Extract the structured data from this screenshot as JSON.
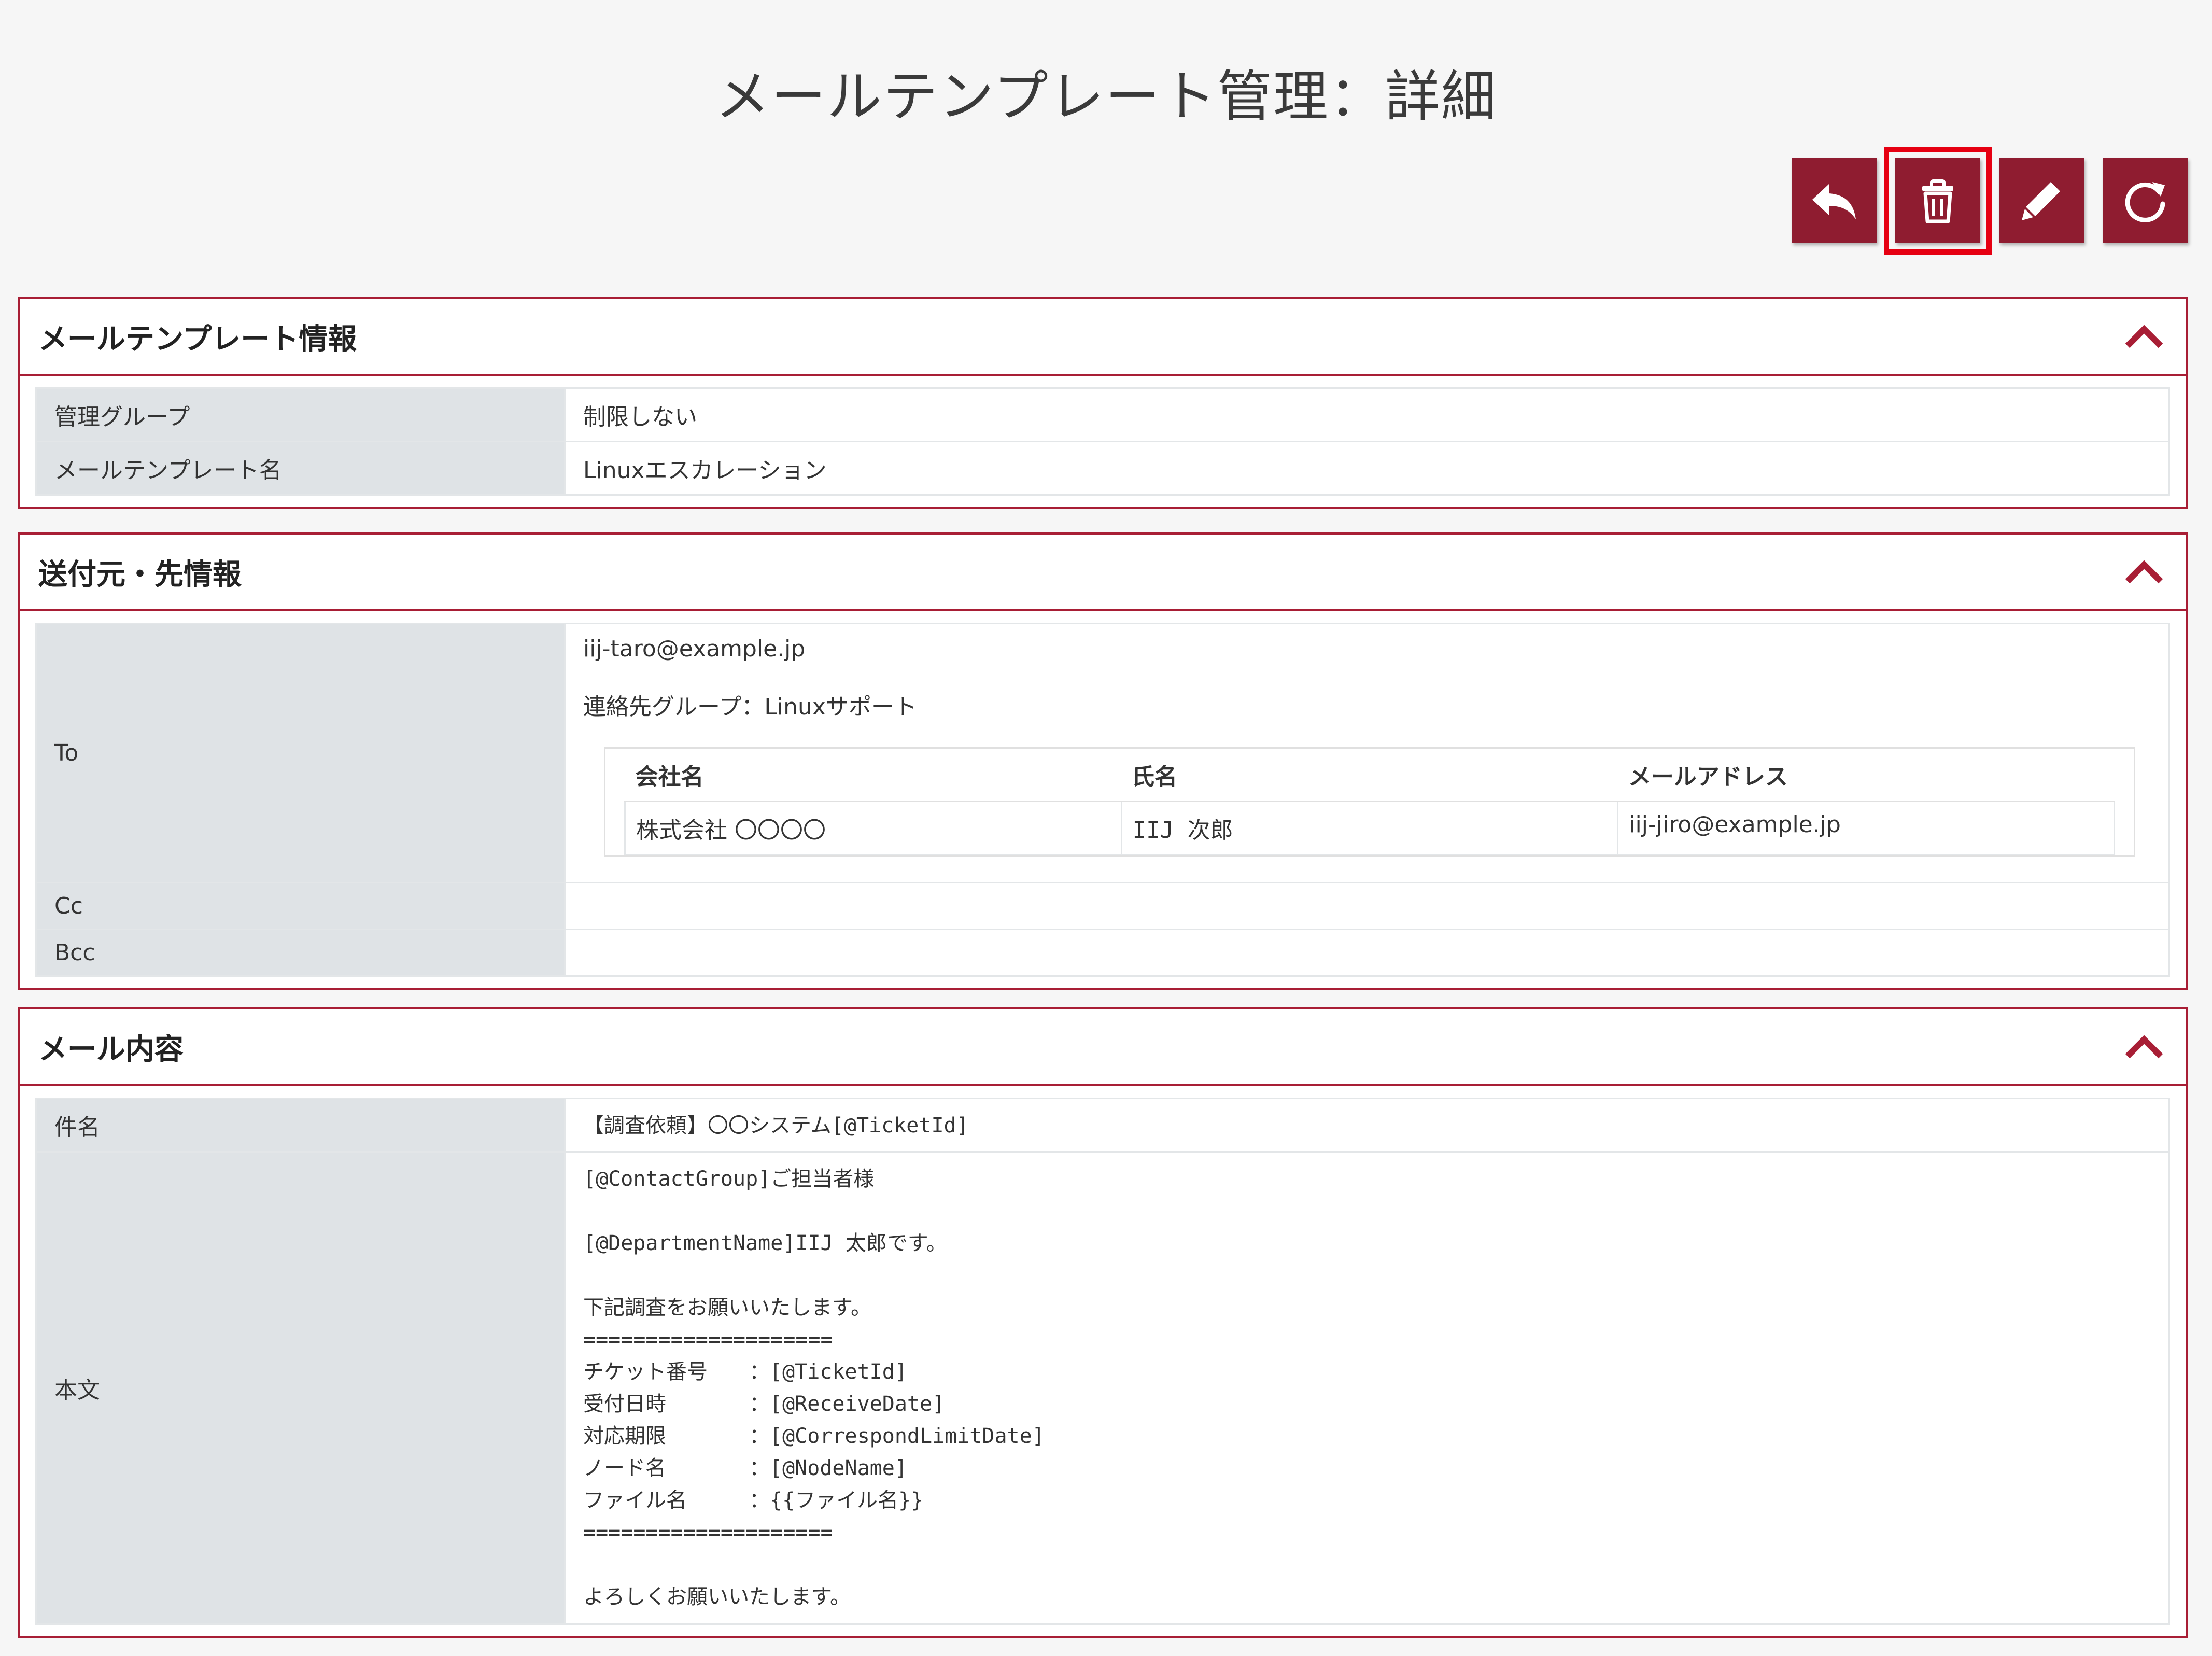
{
  "page": {
    "title": "メールテンプレート管理：詳細"
  },
  "toolbar": {
    "buttons": [
      {
        "name": "back-button",
        "icon": "back-arrow-icon"
      },
      {
        "name": "delete-button",
        "icon": "trash-icon",
        "highlighted": true
      },
      {
        "name": "edit-button",
        "icon": "pencil-icon"
      },
      {
        "name": "refresh-button",
        "icon": "refresh-icon"
      }
    ],
    "colors": {
      "button_bg": "#8f1c30",
      "highlight_border": "#e60012"
    }
  },
  "template_info": {
    "title": "メールテンプレート情報",
    "rows": [
      {
        "label": "管理グループ",
        "value": "制限しない"
      },
      {
        "label": "メールテンプレート名",
        "value": "Linuxエスカレーション"
      }
    ]
  },
  "recipients": {
    "title": "送付元・先情報",
    "to": {
      "label": "To",
      "email": "iij-taro@example.jp",
      "group_line": "連絡先グループ：Linuxサポート",
      "table": {
        "headers": [
          "会社名",
          "氏名",
          "メールアドレス"
        ],
        "rows": [
          [
            "株式会社 〇〇〇〇",
            "IIJ 次郎",
            "iij-jiro@example.jp"
          ]
        ]
      }
    },
    "cc": {
      "label": "Cc",
      "value": ""
    },
    "bcc": {
      "label": "Bcc",
      "value": ""
    }
  },
  "mail_content": {
    "title": "メール内容",
    "subject_label": "件名",
    "subject": "【調査依頼】〇〇システム[@TicketId]",
    "body_label": "本文",
    "body": "[@ContactGroup]ご担当者様\n\n[@DepartmentName]IIJ 太郎です。\n\n下記調査をお願いいたします。\n====================\nチケット番号　　：[@TicketId]\n受付日時　　　　：[@ReceiveDate]\n対応期限　　　　：[@CorrespondLimitDate]\nノード名　　　　：[@NodeName]\nファイル名　　　：{{ファイル名}}\n====================\n\nよろしくお願いいたします。"
  },
  "theme": {
    "accent": "#a81e35",
    "label_bg": "#dfe3e6",
    "page_bg": "#f6f6f6"
  }
}
